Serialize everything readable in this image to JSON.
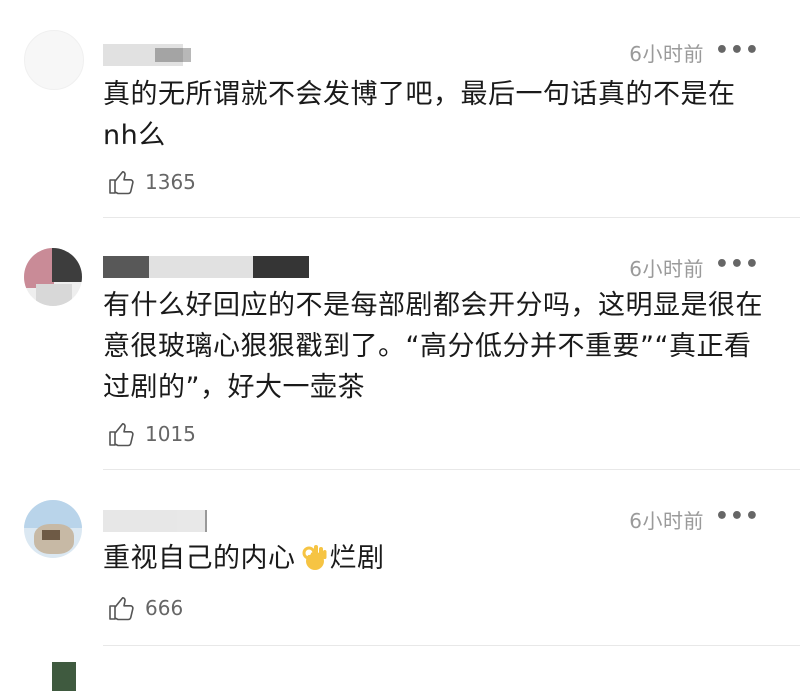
{
  "comments": [
    {
      "time": "6小时前",
      "more": "•••",
      "text": "真的无所谓就不会发博了吧，最后一句话真的不是在nh么",
      "likes": "1365"
    },
    {
      "time": "6小时前",
      "more": "•••",
      "text": "有什么好回应的不是每部剧都会开分吗，这明显是很在意很玻璃心狠狠戳到了。“高分低分并不重要”“真正看过剧的”，好大一壶茶",
      "likes": "1015"
    },
    {
      "time": "6小时前",
      "more": "•••",
      "text_before_emoji": "重视自己的内心",
      "emoji": "ok-hand-emoji",
      "text_after_emoji": "烂剧",
      "likes": "666"
    }
  ]
}
